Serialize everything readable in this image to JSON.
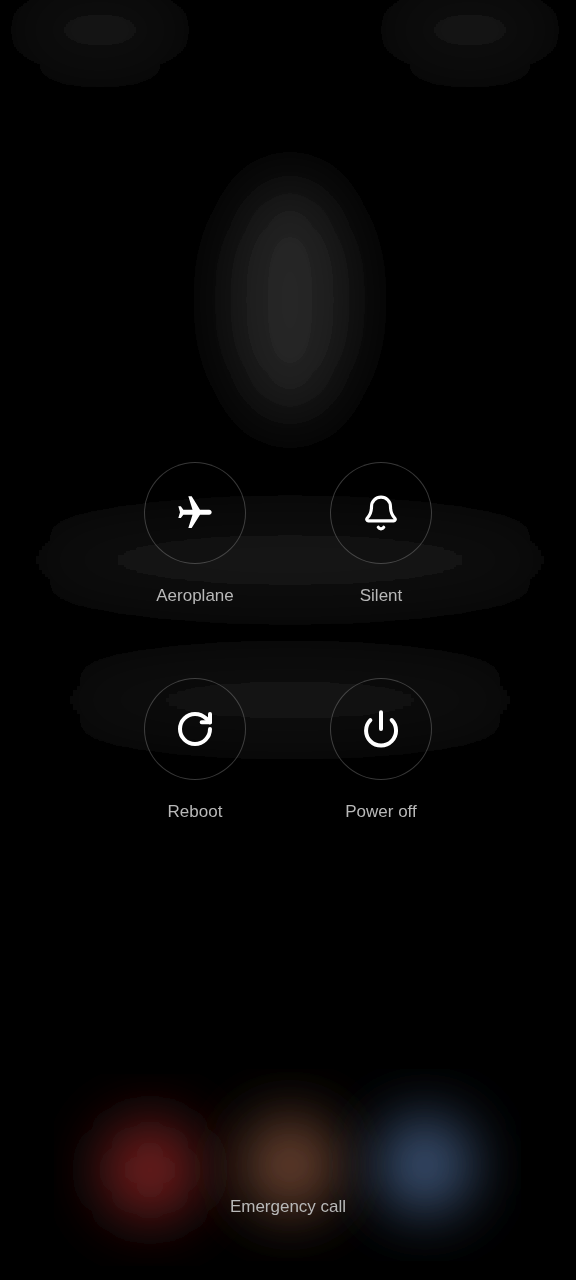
{
  "actions": [
    {
      "kind": "aeroplane",
      "label": "Aeroplane"
    },
    {
      "kind": "silent",
      "label": "Silent"
    },
    {
      "kind": "reboot",
      "label": "Reboot"
    },
    {
      "kind": "power",
      "label": "Power off"
    }
  ],
  "emergency": {
    "label": "Emergency call"
  }
}
